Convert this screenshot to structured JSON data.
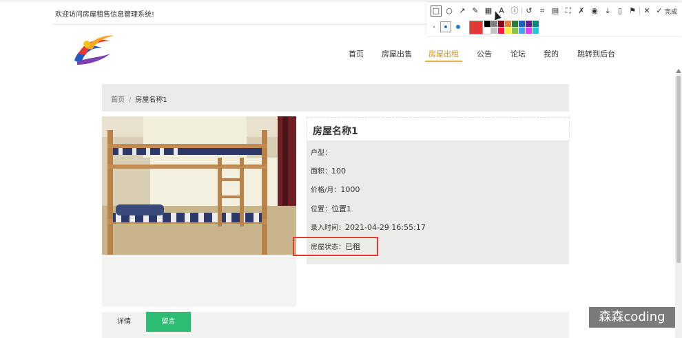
{
  "header": {
    "welcome": "欢迎访问房屋租售信息管理系统!"
  },
  "nav": {
    "items": [
      {
        "label": "首页"
      },
      {
        "label": "房屋出售"
      },
      {
        "label": "房屋出租",
        "active": true
      },
      {
        "label": "公告"
      },
      {
        "label": "论坛"
      },
      {
        "label": "我的"
      },
      {
        "label": "跳转到后台"
      }
    ],
    "accent_color": "#e4b53c"
  },
  "toolbar": {
    "tools": [
      "rectangle-icon",
      "circle-icon",
      "arrow-icon",
      "pencil-icon",
      "mosaic-icon",
      "text-icon",
      "number-icon",
      "undo-icon",
      "crop-icon",
      "ocr-icon",
      "fullscreen-icon",
      "pin-icon",
      "record-icon",
      "download-icon",
      "save-icon",
      "bookmark-icon",
      "close-icon",
      "check-icon"
    ],
    "done_label": "完成",
    "selected_color": "#e53935",
    "palette": [
      "#000000",
      "#7f7f7f",
      "#880015",
      "#ed7d31",
      "#2e7d32",
      "#1565c0",
      "#6a1b9a",
      "#00897b",
      "#ffffff",
      "#c3c3c3",
      "#ff1744",
      "#ffeb3b",
      "#8bc34a",
      "#42a5f5",
      "#e040fb",
      "#26c6da"
    ]
  },
  "breadcrumb": {
    "home": "首页",
    "separator": "/",
    "current": "房屋名称1"
  },
  "house": {
    "name": "房屋名称1",
    "fields": [
      {
        "label": "户型：",
        "value": ""
      },
      {
        "label": "面积：",
        "value": "100"
      },
      {
        "label": "价格/月：",
        "value": "1000"
      },
      {
        "label": "位置：",
        "value": "位置1"
      },
      {
        "label": "录入时间：",
        "value": "2021-04-29 16:55:17"
      },
      {
        "label": "房屋状态：",
        "value": "已租"
      }
    ]
  },
  "tabs": [
    {
      "label": "详情",
      "active": false
    },
    {
      "label": "留言",
      "active": true
    }
  ],
  "tab_active_color": "#2bbd74",
  "highlight_color": "#e53935",
  "watermark": "森森coding"
}
